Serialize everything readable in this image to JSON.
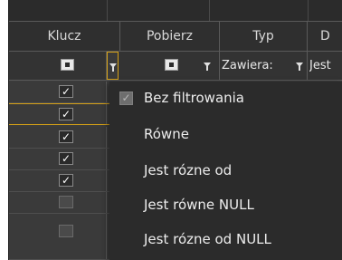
{
  "columns": {
    "klucz": "Klucz",
    "pobierz": "Pobierz",
    "typ": "Typ",
    "d": "D"
  },
  "filter_row": {
    "typ_filter_text": "Zawiera:",
    "d_filter_text": "Jest"
  },
  "rows": [
    {
      "checked": true,
      "mark": "✓"
    },
    {
      "checked": true,
      "mark": "✓"
    },
    {
      "checked": true,
      "mark": "✓"
    },
    {
      "checked": true,
      "mark": "✓"
    },
    {
      "checked": true,
      "mark": "✓"
    },
    {
      "checked": false,
      "mark": ""
    },
    {
      "checked": false,
      "mark": ""
    }
  ],
  "filter_menu": {
    "items": [
      {
        "label": "Bez filtrowania",
        "selected": true,
        "mark": "✓"
      },
      {
        "label": "Równe",
        "selected": false
      },
      {
        "label": "Jest rózne od",
        "selected": false
      },
      {
        "label": "Jest równe NULL",
        "selected": false
      },
      {
        "label": "Jest rózne od NULL",
        "selected": false
      }
    ]
  },
  "colors": {
    "background": "#3c3c3c",
    "header": "#2f2f2f",
    "menu": "#2b2b2b",
    "accent": "#d4a017",
    "text": "#ededed"
  }
}
